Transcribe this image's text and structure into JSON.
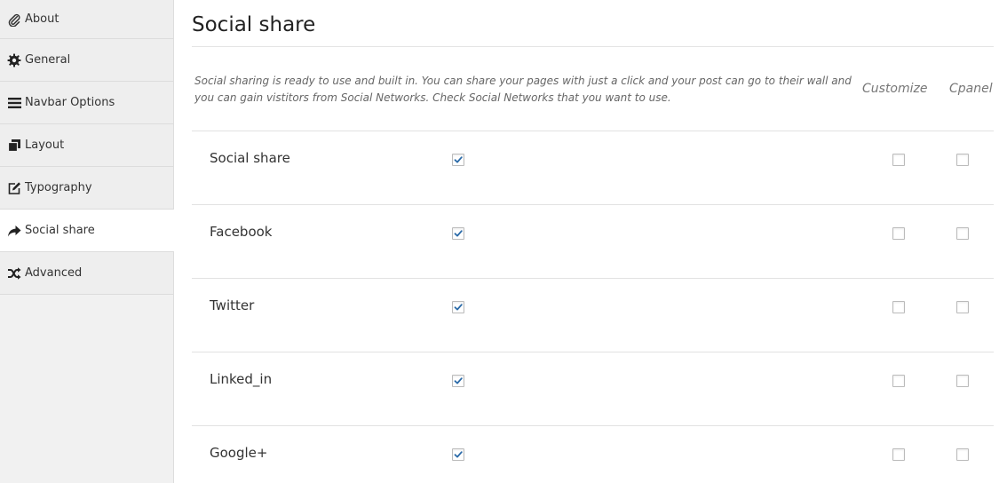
{
  "sidebar": {
    "items": [
      {
        "label": "About",
        "icon": "paperclip-icon",
        "active": false
      },
      {
        "label": "General",
        "icon": "gear-icon",
        "active": false
      },
      {
        "label": "Navbar Options",
        "icon": "menu-bars-icon",
        "active": false
      },
      {
        "label": "Layout",
        "icon": "copy-icon",
        "active": false
      },
      {
        "label": "Typography",
        "icon": "edit-icon",
        "active": false
      },
      {
        "label": "Social share",
        "icon": "share-arrow-icon",
        "active": true
      },
      {
        "label": "Advanced",
        "icon": "shuffle-icon",
        "active": false
      }
    ]
  },
  "main": {
    "title": "Social share",
    "description": "Social sharing is ready to use and built in. You can share your pages with just a click and your post can go to their wall and you can gain vistitors from Social Networks. Check Social Networks that you want to use.",
    "columns": {
      "customize": "Customize",
      "cpanel": "Cpanel"
    },
    "rows": [
      {
        "label": "Social share",
        "enabled": true,
        "customize": false,
        "cpanel": false
      },
      {
        "label": "Facebook",
        "enabled": true,
        "customize": false,
        "cpanel": false
      },
      {
        "label": "Twitter",
        "enabled": true,
        "customize": false,
        "cpanel": false
      },
      {
        "label": "Linked_in",
        "enabled": true,
        "customize": false,
        "cpanel": false
      },
      {
        "label": "Google+",
        "enabled": true,
        "customize": false,
        "cpanel": false
      }
    ]
  },
  "colors": {
    "checkmark": "#2a6aa8",
    "sidebar_bg": "#eeeeee",
    "active_bg": "#ffffff"
  }
}
